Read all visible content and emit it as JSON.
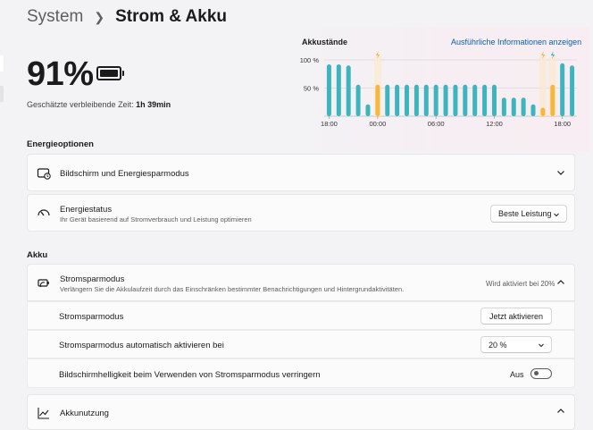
{
  "breadcrumb": {
    "root": "System",
    "current": "Strom & Akku"
  },
  "battery": {
    "percent": "91%",
    "remaining_label": "Geschätzte verbleibende Zeit:",
    "remaining_value": "1h 39min"
  },
  "chart_data": {
    "type": "bar",
    "title": "Akkustände",
    "link": "Ausführliche Informationen anzeigen",
    "y_ticks": [
      "100 %",
      "50 %"
    ],
    "x_ticks": [
      "18:00",
      "00:00",
      "06:00",
      "12:00",
      "18:00"
    ],
    "ylim": [
      0,
      100
    ],
    "values": [
      92,
      92,
      90,
      56,
      21,
      56,
      56,
      56,
      56,
      56,
      56,
      56,
      56,
      56,
      56,
      56,
      56,
      56,
      33,
      33,
      33,
      21,
      15,
      56,
      94,
      90
    ],
    "charging": [
      false,
      false,
      false,
      false,
      false,
      true,
      false,
      false,
      false,
      false,
      false,
      false,
      false,
      false,
      false,
      false,
      false,
      false,
      false,
      false,
      false,
      false,
      true,
      true,
      false,
      false
    ],
    "colors": {
      "normal": "#3db5bf",
      "charging": "#f6b73f",
      "grid": "#d8d8d8"
    }
  },
  "energy_options": {
    "heading": "Energieoptionen",
    "screen_sleep": {
      "title": "Bildschirm und Energiesparmodus"
    },
    "power_mode": {
      "title": "Energiestatus",
      "subtitle": "Ihr Gerät basierend auf Stromverbrauch und Leistung optimieren",
      "value": "Beste Leistung"
    }
  },
  "akku": {
    "heading": "Akku",
    "saver": {
      "title": "Stromsparmodus",
      "subtitle": "Verlängern Sie die Akkulaufzeit durch das Einschränken bestimmter Benachrichtigungen und Hintergrundaktivitäten.",
      "status": "Wird aktiviert bei 20%",
      "row1_label": "Stromsparmodus",
      "row1_button": "Jetzt aktivieren",
      "row2_label": "Stromsparmodus automatisch aktivieren bei",
      "row2_value": "20 %",
      "row3_label": "Bildschirmhelligkeit beim Verwenden von Stromsparmodus verringern",
      "row3_state": "Aus"
    },
    "usage": {
      "title": "Akkunutzung"
    }
  }
}
